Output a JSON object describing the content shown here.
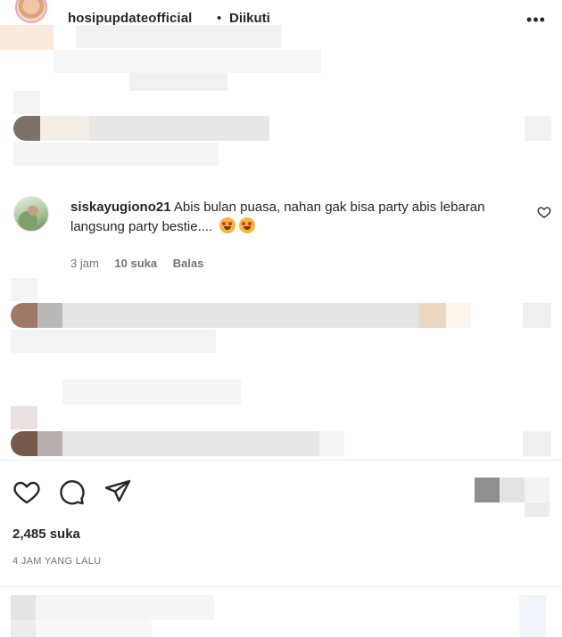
{
  "post": {
    "account": "hosipupdateofficial",
    "separator": "•",
    "follow_status": "Diikuti",
    "likes": "2,485 suka",
    "time_ago": "4 JAM YANG LALU"
  },
  "comment": {
    "username": "siskayugiono21",
    "text": "Abis bulan puasa, nahan gak bisa party abis lebaran langsung party bestie....",
    "time": "3 jam",
    "likes": "10 suka",
    "reply_label": "Balas"
  },
  "icons": {
    "more": "more-options-icon",
    "heart": "heart-icon",
    "comment": "comment-icon",
    "share": "send-icon",
    "emoji": "star-struck-emoji"
  }
}
